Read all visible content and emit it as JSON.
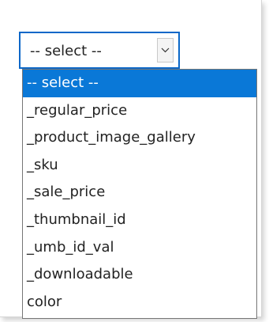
{
  "select": {
    "value": "-- select --",
    "arrow_icon": "chevron-down-icon"
  },
  "options": [
    "-- select --",
    "_regular_price",
    "_product_image_gallery",
    "_sku",
    "_sale_price",
    "_thumbnail_id",
    "_umb_id_val",
    "_downloadable",
    "color"
  ],
  "selected_index": 0,
  "colors": {
    "focus_border": "#0a67c8",
    "selected_background": "#0a78d7",
    "selected_text": "#ffffff",
    "list_border": "#767676",
    "text": "#222222"
  }
}
